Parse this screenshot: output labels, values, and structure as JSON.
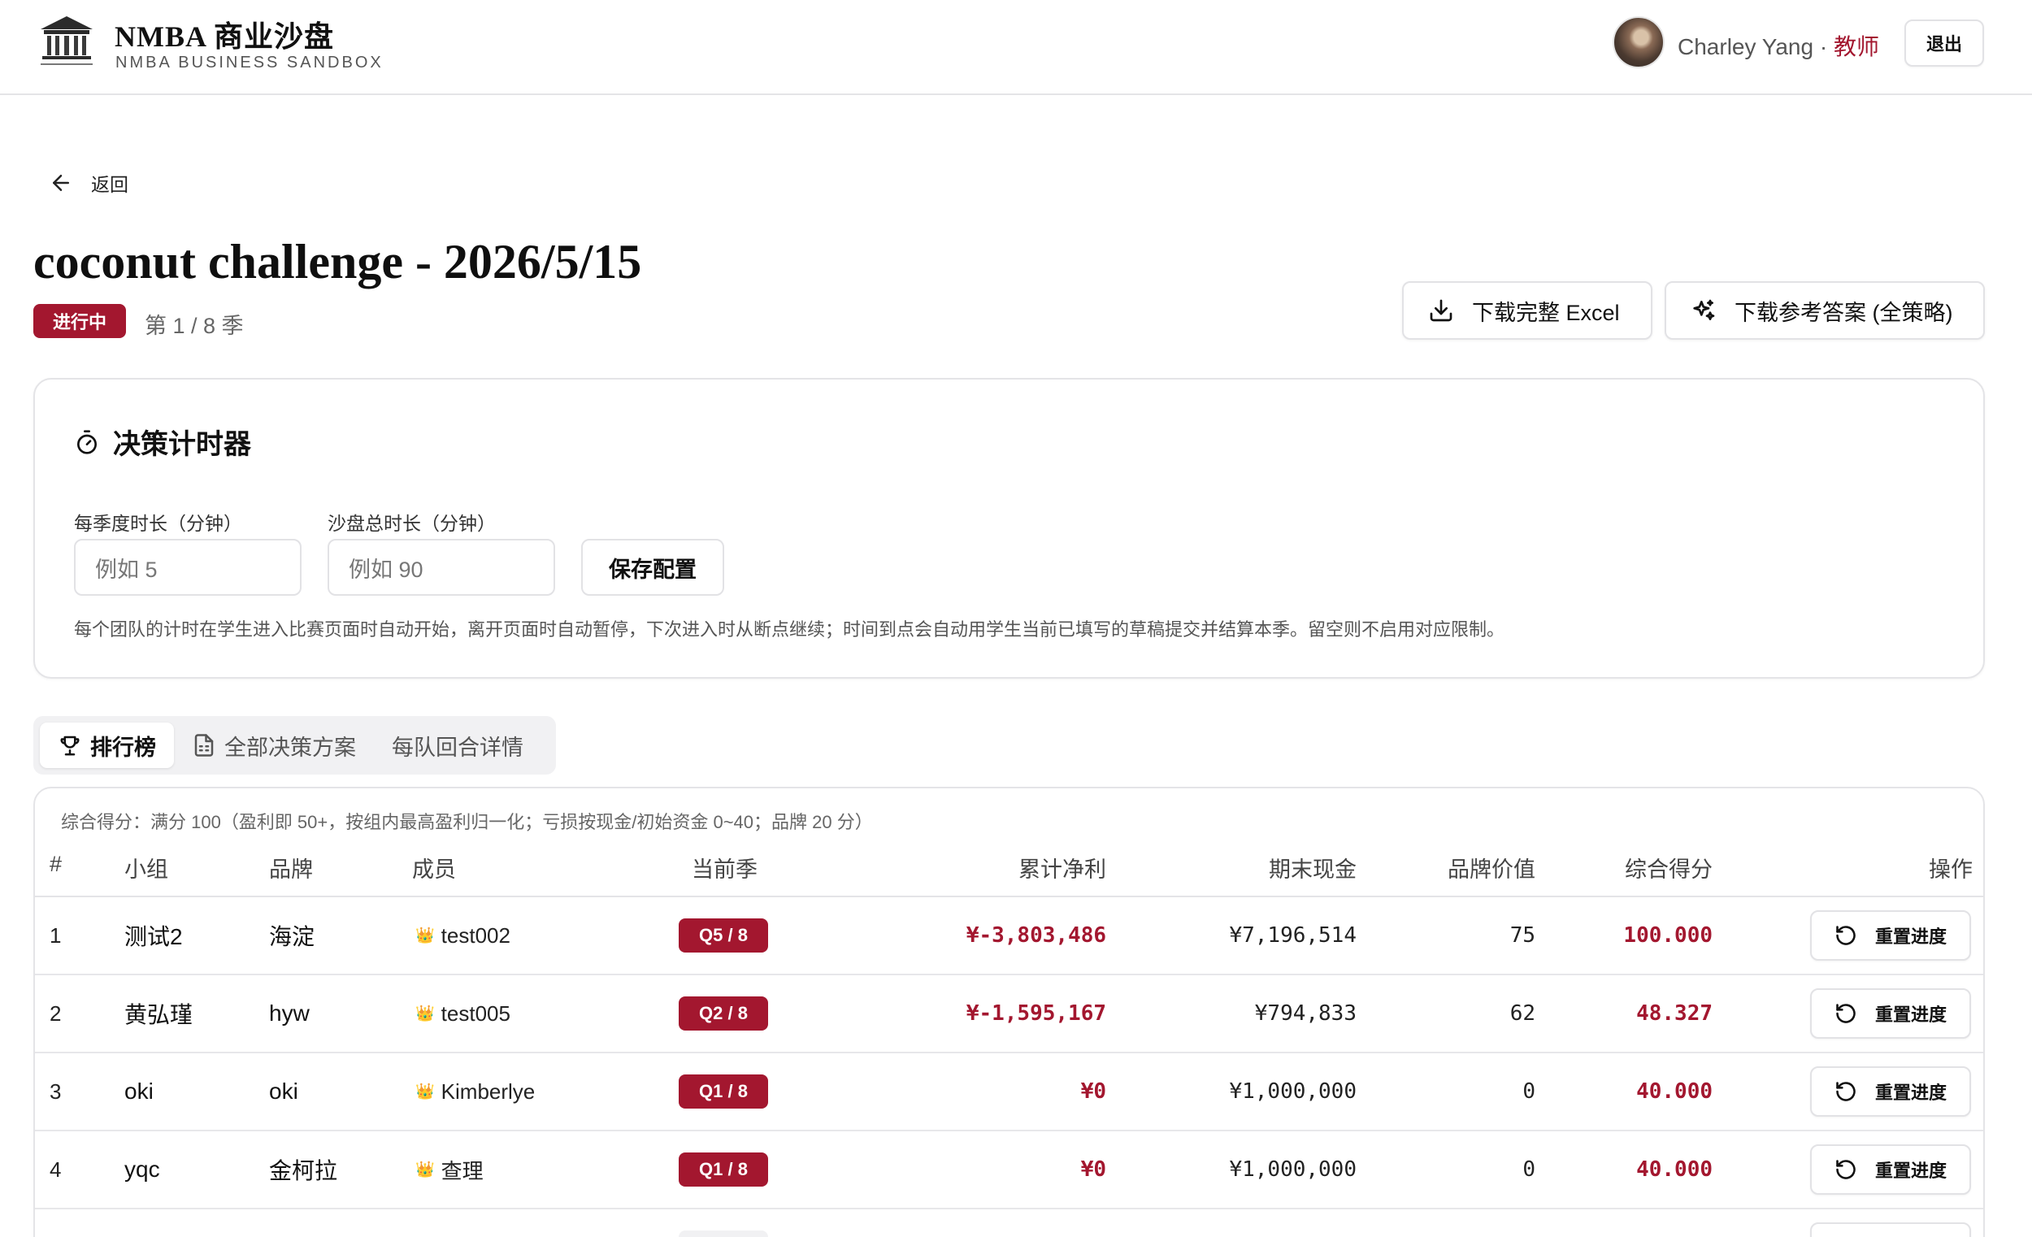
{
  "header": {
    "brand_title": "NMBA 商业沙盘",
    "brand_subtitle": "NMBA BUSINESS SANDBOX",
    "user_name": "Charley Yang",
    "user_separator": " · ",
    "user_role": "教师",
    "logout_label": "退出"
  },
  "nav": {
    "back_label": "返回"
  },
  "page": {
    "title": "coconut challenge - 2026/5/15",
    "status": "进行中",
    "season": "第 1 / 8 季",
    "download_excel": "下载完整 Excel",
    "download_answer": "下载参考答案 (全策略)"
  },
  "timer": {
    "title": "决策计时器",
    "season_label": "每季度时长（分钟）",
    "season_placeholder": "例如 5",
    "total_label": "沙盘总时长（分钟）",
    "total_placeholder": "例如 90",
    "save_label": "保存配置",
    "note": "每个团队的计时在学生进入比赛页面时自动开始，离开页面时自动暂停，下次进入时从断点继续；时间到点会自动用学生当前已填写的草稿提交并结算本季。留空则不启用对应限制。"
  },
  "tabs": [
    {
      "label": "排行榜",
      "icon": "trophy-icon"
    },
    {
      "label": "全部决策方案",
      "icon": "document-icon"
    },
    {
      "label": "每队回合详情"
    }
  ],
  "leaderboard": {
    "score_note": "综合得分：满分 100（盈利即 50+，按组内最高盈利归一化；亏损按现金/初始资金 0~40；品牌 20 分）",
    "columns": {
      "rank": "#",
      "team": "小组",
      "brand": "品牌",
      "members": "成员",
      "season": "当前季",
      "net_profit": "累计净利",
      "cash": "期末现金",
      "brand_value": "品牌价值",
      "score": "综合得分",
      "actions": "操作"
    },
    "reset_label": "重置进度",
    "rows": [
      {
        "rank": "1",
        "team": "测试2",
        "brand": "海淀",
        "member": "test002",
        "season": "Q5 / 8",
        "net_profit": "¥-3,803,486",
        "cash": "¥7,196,514",
        "brand_value": "75",
        "score": "100.000"
      },
      {
        "rank": "2",
        "team": "黄弘瑾",
        "brand": "hyw",
        "member": "test005",
        "season": "Q2 / 8",
        "net_profit": "¥-1,595,167",
        "cash": "¥794,833",
        "brand_value": "62",
        "score": "48.327"
      },
      {
        "rank": "3",
        "team": "oki",
        "brand": "oki",
        "member": "Kimberlye",
        "season": "Q1 / 8",
        "net_profit": "¥0",
        "cash": "¥1,000,000",
        "brand_value": "0",
        "score": "40.000"
      },
      {
        "rank": "4",
        "team": "yqc",
        "brand": "金柯拉",
        "member": "查理",
        "season": "Q1 / 8",
        "net_profit": "¥0",
        "cash": "¥1,000,000",
        "brand_value": "0",
        "score": "40.000"
      }
    ]
  },
  "colors": {
    "accent": "#a3172f",
    "border": "#e4e4e7"
  }
}
